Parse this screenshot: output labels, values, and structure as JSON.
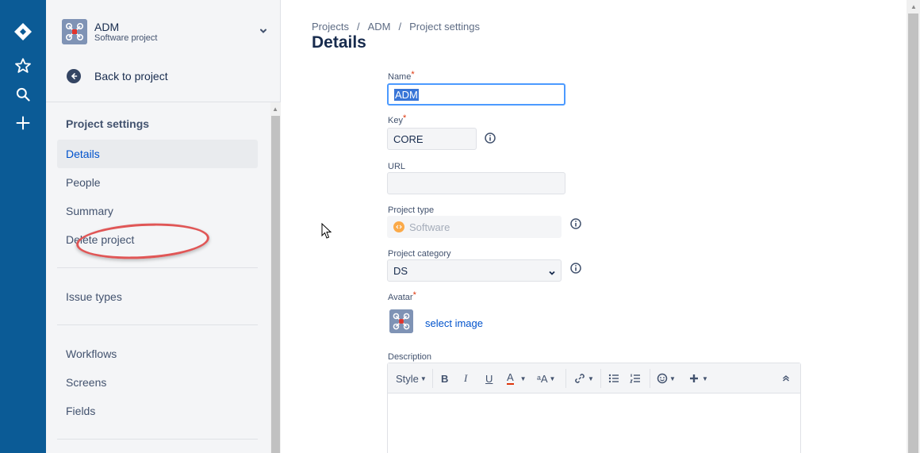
{
  "global_nav": {
    "icons": [
      "jira-logo-icon",
      "star-icon",
      "search-icon",
      "plus-icon"
    ]
  },
  "project": {
    "name": "ADM",
    "type": "Software project"
  },
  "sidebar": {
    "back_label": "Back to project",
    "section_title": "Project settings",
    "items": [
      {
        "label": "Details",
        "active": true
      },
      {
        "label": "People"
      },
      {
        "label": "Summary"
      },
      {
        "label": "Delete project"
      },
      {
        "label": "Issue types"
      },
      {
        "label": "Workflows"
      },
      {
        "label": "Screens"
      },
      {
        "label": "Fields"
      }
    ]
  },
  "breadcrumbs": [
    "Projects",
    "ADM",
    "Project settings"
  ],
  "breadcrumb_separator": "/",
  "page_title": "Details",
  "form": {
    "name": {
      "label": "Name",
      "value": "ADM"
    },
    "key": {
      "label": "Key",
      "value": "CORE"
    },
    "url": {
      "label": "URL",
      "value": ""
    },
    "project_type": {
      "label": "Project type",
      "value": "Software"
    },
    "project_category": {
      "label": "Project category",
      "value": "DS"
    },
    "avatar": {
      "label": "Avatar",
      "link": "select image"
    },
    "description": {
      "label": "Description"
    },
    "required_mark": "*"
  },
  "editor_toolbar": {
    "style_label": "Style",
    "bold": "B",
    "italic": "I",
    "underline": "U",
    "text_color": "A",
    "text_size": "ᵃA"
  },
  "colors": {
    "rail": "#0b5b96",
    "link": "#0052cc",
    "annotation": "#e05656",
    "focus": "#4c9aff"
  }
}
